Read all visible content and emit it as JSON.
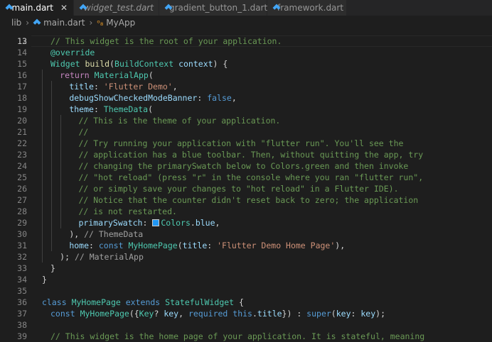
{
  "tabs": [
    {
      "label": "main.dart",
      "close": "✕"
    },
    {
      "label": "widget_test.dart"
    },
    {
      "label": "gradient_button_1.dart"
    },
    {
      "label": "framework.dart"
    }
  ],
  "breadcrumb": {
    "folder": "lib",
    "file": "main.dart",
    "symbol": "MyApp"
  },
  "current_line": 13,
  "partial_top_line": "12",
  "lines": [
    {
      "n": "13",
      "indent": 1,
      "tokens": [
        [
          "cm",
          "// This widget is the root of your application."
        ]
      ]
    },
    {
      "n": "14",
      "indent": 1,
      "tokens": [
        [
          "dec",
          "@override"
        ]
      ]
    },
    {
      "n": "15",
      "indent": 1,
      "tokens": [
        [
          "ty",
          "Widget"
        ],
        [
          "pl",
          " "
        ],
        [
          "fn",
          "build"
        ],
        [
          "pl",
          "("
        ],
        [
          "ty",
          "BuildContext"
        ],
        [
          "pl",
          " "
        ],
        [
          "pr",
          "context"
        ],
        [
          "pl",
          ") {"
        ]
      ]
    },
    {
      "n": "16",
      "indent": 2,
      "tokens": [
        [
          "kw2",
          "return"
        ],
        [
          "pl",
          " "
        ],
        [
          "ty",
          "MaterialApp"
        ],
        [
          "pl",
          "("
        ]
      ]
    },
    {
      "n": "17",
      "indent": 3,
      "tokens": [
        [
          "pr",
          "title"
        ],
        [
          "pl",
          ": "
        ],
        [
          "str",
          "'Flutter Demo'"
        ],
        [
          "pl",
          ","
        ]
      ]
    },
    {
      "n": "18",
      "indent": 3,
      "tokens": [
        [
          "pr",
          "debugShowCheckedModeBanner"
        ],
        [
          "pl",
          ": "
        ],
        [
          "kw",
          "false"
        ],
        [
          "pl",
          ","
        ]
      ]
    },
    {
      "n": "19",
      "indent": 3,
      "tokens": [
        [
          "pr",
          "theme"
        ],
        [
          "pl",
          ": "
        ],
        [
          "ty",
          "ThemeData"
        ],
        [
          "pl",
          "("
        ]
      ]
    },
    {
      "n": "20",
      "indent": 4,
      "tokens": [
        [
          "cm",
          "// This is the theme of your application."
        ]
      ]
    },
    {
      "n": "21",
      "indent": 4,
      "tokens": [
        [
          "cm",
          "//"
        ]
      ]
    },
    {
      "n": "22",
      "indent": 4,
      "tokens": [
        [
          "cm",
          "// Try running your application with \"flutter run\". You'll see the"
        ]
      ]
    },
    {
      "n": "23",
      "indent": 4,
      "tokens": [
        [
          "cm",
          "// application has a blue toolbar. Then, without quitting the app, try"
        ]
      ]
    },
    {
      "n": "24",
      "indent": 4,
      "tokens": [
        [
          "cm",
          "// changing the primarySwatch below to Colors.green and then invoke"
        ]
      ]
    },
    {
      "n": "25",
      "indent": 4,
      "tokens": [
        [
          "cm",
          "// \"hot reload\" (press \"r\" in the console where you ran \"flutter run\","
        ]
      ]
    },
    {
      "n": "26",
      "indent": 4,
      "tokens": [
        [
          "cm",
          "// or simply save your changes to \"hot reload\" in a Flutter IDE)."
        ]
      ]
    },
    {
      "n": "27",
      "indent": 4,
      "tokens": [
        [
          "cm",
          "// Notice that the counter didn't reset back to zero; the application"
        ]
      ]
    },
    {
      "n": "28",
      "indent": 4,
      "tokens": [
        [
          "cm",
          "// is not restarted."
        ]
      ]
    },
    {
      "n": "29",
      "indent": 4,
      "tokens": [
        [
          "pr",
          "primarySwatch"
        ],
        [
          "pl",
          ": "
        ],
        [
          "swatch",
          ""
        ],
        [
          "ty",
          "Colors"
        ],
        [
          "pl",
          "."
        ],
        [
          "pr",
          "blue"
        ],
        [
          "pl",
          ","
        ]
      ]
    },
    {
      "n": "30",
      "indent": 3,
      "tokens": [
        [
          "pl",
          "), "
        ],
        [
          "hint",
          "// ThemeData"
        ]
      ]
    },
    {
      "n": "31",
      "indent": 3,
      "tokens": [
        [
          "pr",
          "home"
        ],
        [
          "pl",
          ": "
        ],
        [
          "kw",
          "const"
        ],
        [
          "pl",
          " "
        ],
        [
          "ty",
          "MyHomePage"
        ],
        [
          "pl",
          "("
        ],
        [
          "pr",
          "title"
        ],
        [
          "pl",
          ": "
        ],
        [
          "str",
          "'Flutter Demo Home Page'"
        ],
        [
          "pl",
          "),"
        ]
      ]
    },
    {
      "n": "32",
      "indent": 2,
      "tokens": [
        [
          "pl",
          "); "
        ],
        [
          "hint",
          "// MaterialApp"
        ]
      ]
    },
    {
      "n": "33",
      "indent": 1,
      "tokens": [
        [
          "pl",
          "}"
        ]
      ]
    },
    {
      "n": "34",
      "indent": 0,
      "tokens": [
        [
          "pl",
          "}"
        ]
      ]
    },
    {
      "n": "35",
      "indent": 0,
      "tokens": []
    },
    {
      "n": "36",
      "indent": 0,
      "tokens": [
        [
          "kw",
          "class"
        ],
        [
          "pl",
          " "
        ],
        [
          "ty",
          "MyHomePage"
        ],
        [
          "pl",
          " "
        ],
        [
          "kw",
          "extends"
        ],
        [
          "pl",
          " "
        ],
        [
          "ty",
          "StatefulWidget"
        ],
        [
          "pl",
          " {"
        ]
      ]
    },
    {
      "n": "37",
      "indent": 1,
      "tokens": [
        [
          "kw",
          "const"
        ],
        [
          "pl",
          " "
        ],
        [
          "ty",
          "MyHomePage"
        ],
        [
          "pl",
          "({"
        ],
        [
          "ty",
          "Key"
        ],
        [
          "pl",
          "? "
        ],
        [
          "pr",
          "key"
        ],
        [
          "pl",
          ", "
        ],
        [
          "kw",
          "required"
        ],
        [
          "pl",
          " "
        ],
        [
          "kw",
          "this"
        ],
        [
          "pl",
          "."
        ],
        [
          "pr",
          "title"
        ],
        [
          "pl",
          "}) : "
        ],
        [
          "kw",
          "super"
        ],
        [
          "pl",
          "("
        ],
        [
          "pr",
          "key"
        ],
        [
          "pl",
          ": "
        ],
        [
          "pr",
          "key"
        ],
        [
          "pl",
          ");"
        ]
      ]
    },
    {
      "n": "38",
      "indent": 0,
      "tokens": []
    },
    {
      "n": "39",
      "indent": 1,
      "tokens": [
        [
          "cm",
          "// This widget is the home page of your application. It is stateful, meaning"
        ]
      ]
    }
  ]
}
